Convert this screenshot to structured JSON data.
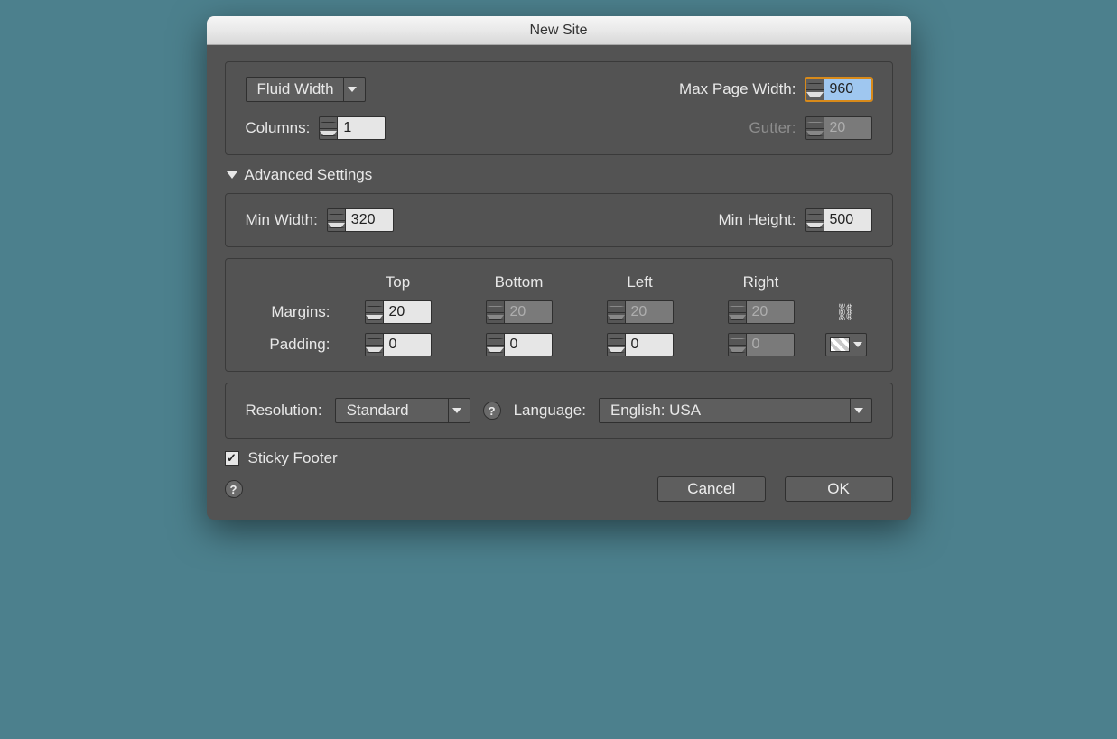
{
  "dialog": {
    "title": "New Site"
  },
  "layoutSection": {
    "widthMode": "Fluid Width",
    "maxPageWidthLabel": "Max Page Width:",
    "maxPageWidth": "960",
    "columnsLabel": "Columns:",
    "columns": "1",
    "gutterLabel": "Gutter:",
    "gutter": "20"
  },
  "advanced": {
    "title": "Advanced Settings",
    "minWidthLabel": "Min Width:",
    "minWidth": "320",
    "minHeightLabel": "Min Height:",
    "minHeight": "500"
  },
  "box": {
    "topLabel": "Top",
    "bottomLabel": "Bottom",
    "leftLabel": "Left",
    "rightLabel": "Right",
    "marginsLabel": "Margins:",
    "margins": {
      "top": "20",
      "bottom": "20",
      "left": "20",
      "right": "20"
    },
    "paddingLabel": "Padding:",
    "padding": {
      "top": "0",
      "bottom": "0",
      "left": "0",
      "right": "0"
    }
  },
  "options": {
    "resolutionLabel": "Resolution:",
    "resolution": "Standard",
    "languageLabel": "Language:",
    "language": "English: USA"
  },
  "footer": {
    "stickyLabel": "Sticky Footer",
    "stickyChecked": true,
    "cancel": "Cancel",
    "ok": "OK"
  }
}
